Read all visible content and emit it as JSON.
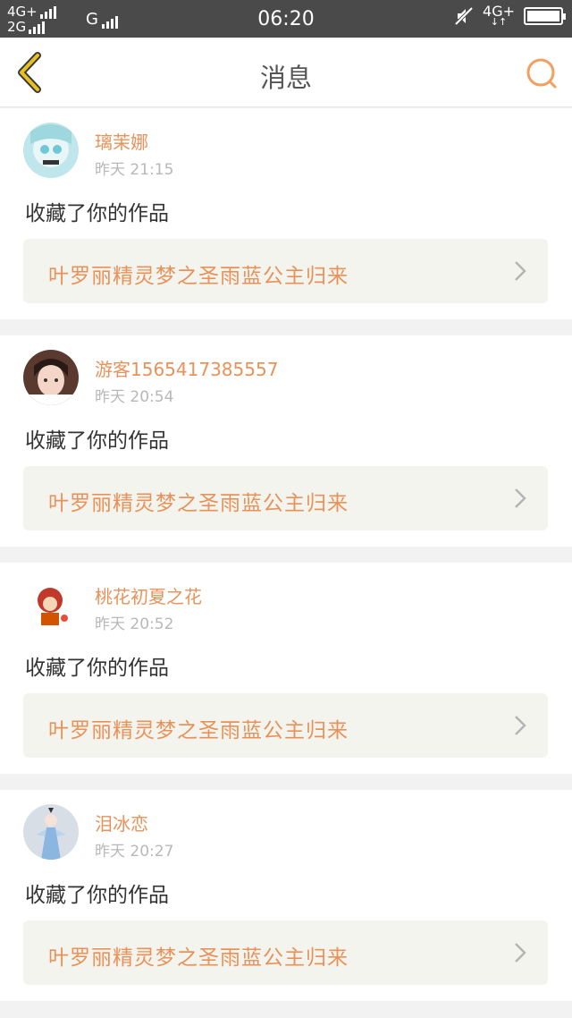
{
  "status_bar": {
    "net_top": "4G+",
    "net_bottom": "2G",
    "net_g": "G",
    "time": "06:20",
    "net_right": "4G+"
  },
  "header": {
    "title": "消息",
    "back_icon": "chevron-left-icon",
    "search_icon": "search-icon"
  },
  "colors": {
    "accent": "#e8925a",
    "back_arrow": "#e8c020",
    "card_link_bg": "#f4f4ee"
  },
  "notifications": [
    {
      "username": "璃茉娜",
      "time": "昨天 21:15",
      "action": "收藏了你的作品",
      "work_title": "叶罗丽精灵梦之圣雨蓝公主归来"
    },
    {
      "username": "游客1565417385557",
      "time": "昨天 20:54",
      "action": "收藏了你的作品",
      "work_title": "叶罗丽精灵梦之圣雨蓝公主归来"
    },
    {
      "username": "桃花初夏之花",
      "time": "昨天 20:52",
      "action": "收藏了你的作品",
      "work_title": "叶罗丽精灵梦之圣雨蓝公主归来"
    },
    {
      "username": "泪冰恋",
      "time": "昨天 20:27",
      "action": "收藏了你的作品",
      "work_title": "叶罗丽精灵梦之圣雨蓝公主归来"
    }
  ]
}
